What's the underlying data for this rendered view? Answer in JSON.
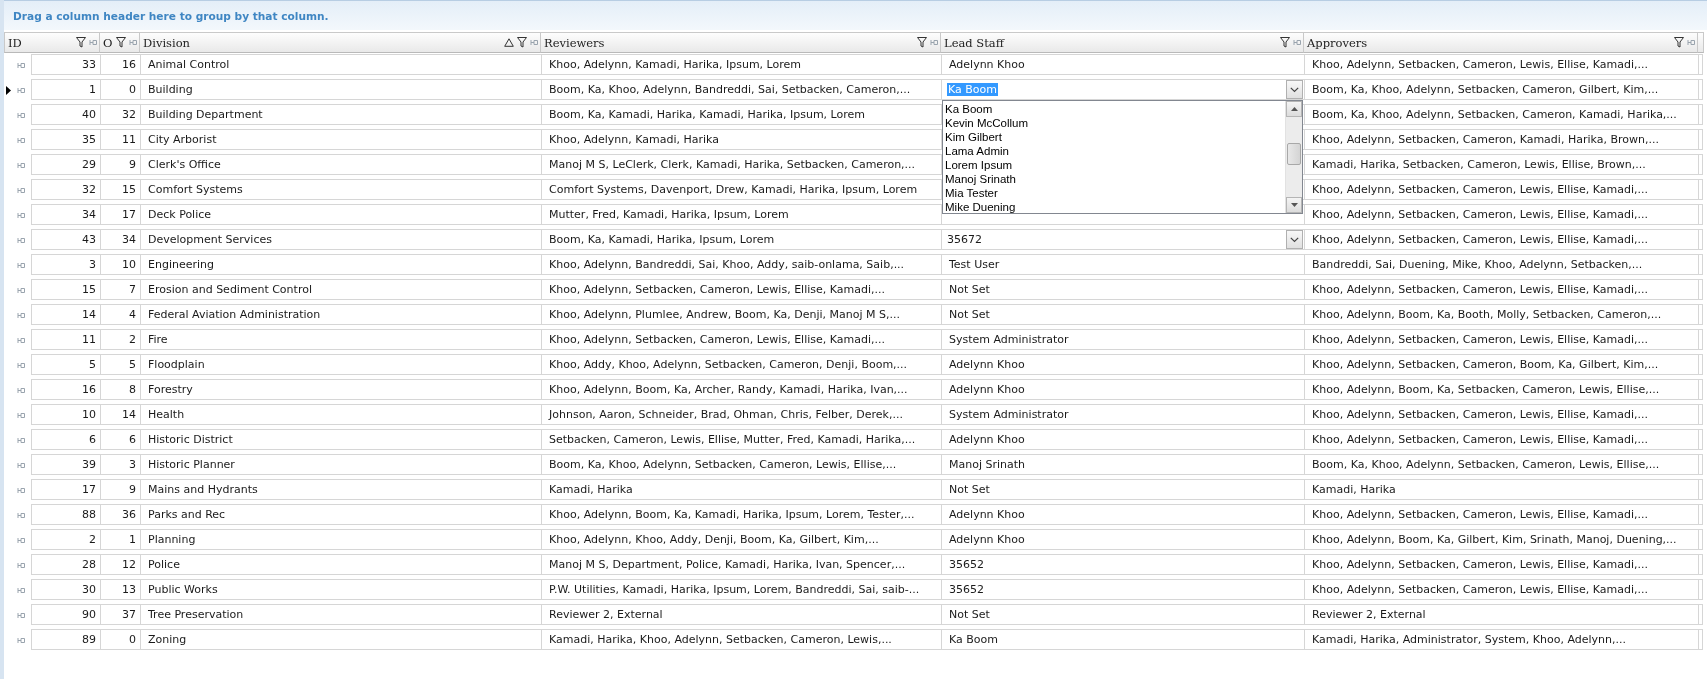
{
  "group_panel": {
    "text": "Drag a column header here to group by that column."
  },
  "columns": [
    {
      "label": "ID",
      "filter": true,
      "sorted": false
    },
    {
      "label": "O",
      "filter": true,
      "sorted": false
    },
    {
      "label": "Division",
      "filter": true,
      "sorted": true
    },
    {
      "label": "Reviewers",
      "filter": true,
      "sorted": false
    },
    {
      "label": "Lead Staff",
      "filter": true,
      "sorted": false
    },
    {
      "label": "Approvers",
      "filter": true,
      "sorted": false
    }
  ],
  "rows": [
    {
      "id": "33",
      "order": "16",
      "division": "Animal Control",
      "reviewers": "Khoo, Adelynn, Kamadi, Harika, Ipsum, Lorem",
      "lead_staff": "Adelynn Khoo",
      "approvers": "Khoo, Adelynn, Setbacken, Cameron, Lewis, Ellise, Kamadi,...",
      "selected": false,
      "editing": false,
      "dropdown_button": false
    },
    {
      "id": "1",
      "order": "0",
      "division": "Building",
      "reviewers": "Boom, Ka, Khoo, Adelynn, Bandreddi, Sai, Setbacken, Cameron,...",
      "lead_staff": "Ka Boom",
      "approvers": "Boom, Ka, Khoo, Adelynn, Setbacken, Cameron, Gilbert, Kim,...",
      "selected": true,
      "editing": true,
      "dropdown_button": true
    },
    {
      "id": "40",
      "order": "32",
      "division": "Building Department",
      "reviewers": "Boom, Ka, Kamadi, Harika, Kamadi, Harika, Ipsum, Lorem",
      "approvers": "Boom, Ka, Khoo, Adelynn, Setbacken, Cameron, Kamadi, Harika,...",
      "selected": false,
      "editing": false,
      "dropdown_button": false
    },
    {
      "id": "35",
      "order": "11",
      "division": "City Arborist",
      "reviewers": "Khoo, Adelynn, Kamadi, Harika",
      "approvers": "Khoo, Adelynn, Setbacken, Cameron, Kamadi, Harika, Brown,...",
      "selected": false,
      "editing": false,
      "dropdown_button": false
    },
    {
      "id": "29",
      "order": "9",
      "division": "Clerk's Office",
      "reviewers": "Manoj M S, LeClerk, Clerk, Kamadi, Harika, Setbacken, Cameron,...",
      "approvers": "Kamadi, Harika, Setbacken, Cameron, Lewis, Ellise, Brown,...",
      "selected": false,
      "editing": false,
      "dropdown_button": false
    },
    {
      "id": "32",
      "order": "15",
      "division": "Comfort Systems",
      "reviewers": "Comfort Systems, Davenport, Drew, Kamadi, Harika, Ipsum, Lorem",
      "approvers": "Khoo, Adelynn, Setbacken, Cameron, Lewis, Ellise, Kamadi,...",
      "selected": false,
      "editing": false,
      "dropdown_button": false
    },
    {
      "id": "34",
      "order": "17",
      "division": "Deck Police",
      "reviewers": "Mutter, Fred, Kamadi, Harika, Ipsum, Lorem",
      "approvers": "Khoo, Adelynn, Setbacken, Cameron, Lewis, Ellise, Kamadi,...",
      "selected": false,
      "editing": false,
      "dropdown_button": false
    },
    {
      "id": "43",
      "order": "34",
      "division": "Development Services",
      "reviewers": "Boom, Ka, Kamadi, Harika, Ipsum, Lorem",
      "lead_staff": "35672",
      "approvers": "Khoo, Adelynn, Setbacken, Cameron, Lewis, Ellise, Kamadi,...",
      "selected": false,
      "editing": false,
      "dropdown_button": true
    },
    {
      "id": "3",
      "order": "10",
      "division": "Engineering",
      "reviewers": "Khoo, Adelynn, Bandreddi, Sai, Khoo, Addy, saib-onlama, Saib,...",
      "lead_staff": "Test User",
      "approvers": "Bandreddi, Sai, Duening, Mike, Khoo, Adelynn, Setbacken,...",
      "selected": false,
      "editing": false,
      "dropdown_button": false
    },
    {
      "id": "15",
      "order": "7",
      "division": "Erosion and Sediment Control",
      "reviewers": "Khoo, Adelynn, Setbacken, Cameron, Lewis, Ellise, Kamadi,...",
      "lead_staff": "Not Set",
      "approvers": "Khoo, Adelynn, Setbacken, Cameron, Lewis, Ellise, Kamadi,...",
      "selected": false,
      "editing": false,
      "dropdown_button": false
    },
    {
      "id": "14",
      "order": "4",
      "division": "Federal Aviation Administration",
      "reviewers": "Khoo, Adelynn, Plumlee, Andrew, Boom, Ka, Denji, Manoj M S,...",
      "lead_staff": "Not Set",
      "approvers": "Khoo, Adelynn, Boom, Ka, Booth, Molly, Setbacken, Cameron,...",
      "selected": false,
      "editing": false,
      "dropdown_button": false
    },
    {
      "id": "11",
      "order": "2",
      "division": "Fire",
      "reviewers": "Khoo, Adelynn, Setbacken, Cameron, Lewis, Ellise, Kamadi,...",
      "lead_staff": "System Administrator",
      "approvers": "Khoo, Adelynn, Setbacken, Cameron, Lewis, Ellise, Kamadi,...",
      "selected": false,
      "editing": false,
      "dropdown_button": false
    },
    {
      "id": "5",
      "order": "5",
      "division": "Floodplain",
      "reviewers": "Khoo, Addy, Khoo, Adelynn, Setbacken, Cameron, Denji, Boom,...",
      "lead_staff": "Adelynn Khoo",
      "approvers": "Khoo, Adelynn, Setbacken, Cameron, Boom, Ka, Gilbert, Kim,...",
      "selected": false,
      "editing": false,
      "dropdown_button": false
    },
    {
      "id": "16",
      "order": "8",
      "division": "Forestry",
      "reviewers": "Khoo, Adelynn, Boom, Ka, Archer, Randy, Kamadi, Harika, Ivan,...",
      "lead_staff": "Adelynn Khoo",
      "approvers": "Khoo, Adelynn, Boom, Ka, Setbacken, Cameron, Lewis, Ellise,...",
      "selected": false,
      "editing": false,
      "dropdown_button": false
    },
    {
      "id": "10",
      "order": "14",
      "division": "Health",
      "reviewers": "Johnson, Aaron, Schneider, Brad, Ohman, Chris, Felber, Derek,...",
      "lead_staff": "System Administrator",
      "approvers": "Khoo, Adelynn, Setbacken, Cameron, Lewis, Ellise, Kamadi,...",
      "selected": false,
      "editing": false,
      "dropdown_button": false
    },
    {
      "id": "6",
      "order": "6",
      "division": "Historic District",
      "reviewers": "Setbacken, Cameron, Lewis, Ellise, Mutter, Fred, Kamadi, Harika,...",
      "lead_staff": "Adelynn Khoo",
      "approvers": "Khoo, Adelynn, Setbacken, Cameron, Lewis, Ellise, Kamadi,...",
      "selected": false,
      "editing": false,
      "dropdown_button": false
    },
    {
      "id": "39",
      "order": "3",
      "division": "Historic Planner",
      "reviewers": "Boom, Ka, Khoo, Adelynn, Setbacken, Cameron, Lewis, Ellise,...",
      "lead_staff": "Manoj Srinath",
      "approvers": "Boom, Ka, Khoo, Adelynn, Setbacken, Cameron, Lewis, Ellise,...",
      "selected": false,
      "editing": false,
      "dropdown_button": false
    },
    {
      "id": "17",
      "order": "9",
      "division": "Mains and Hydrants",
      "reviewers": "Kamadi, Harika",
      "lead_staff": "Not Set",
      "approvers": "Kamadi, Harika",
      "selected": false,
      "editing": false,
      "dropdown_button": false
    },
    {
      "id": "88",
      "order": "36",
      "division": "Parks and Rec",
      "reviewers": "Khoo, Adelynn, Boom, Ka, Kamadi, Harika, Ipsum, Lorem, Tester,...",
      "lead_staff": "Adelynn Khoo",
      "approvers": "Khoo, Adelynn, Setbacken, Cameron, Lewis, Ellise, Kamadi,...",
      "selected": false,
      "editing": false,
      "dropdown_button": false
    },
    {
      "id": "2",
      "order": "1",
      "division": "Planning",
      "reviewers": "Khoo, Adelynn, Khoo, Addy, Denji, Boom, Ka, Gilbert, Kim,...",
      "lead_staff": "Adelynn Khoo",
      "approvers": "Khoo, Adelynn, Boom, Ka, Gilbert, Kim, Srinath, Manoj, Duening,...",
      "selected": false,
      "editing": false,
      "dropdown_button": false
    },
    {
      "id": "28",
      "order": "12",
      "division": "Police",
      "reviewers": "Manoj M S, Department, Police, Kamadi, Harika, Ivan, Spencer,...",
      "lead_staff": "35652",
      "approvers": "Khoo, Adelynn, Setbacken, Cameron, Lewis, Ellise, Kamadi,...",
      "selected": false,
      "editing": false,
      "dropdown_button": false
    },
    {
      "id": "30",
      "order": "13",
      "division": "Public Works",
      "reviewers": "P.W. Utilities, Kamadi, Harika, Ipsum, Lorem, Bandreddi, Sai, saib-...",
      "lead_staff": "35652",
      "approvers": "Khoo, Adelynn, Setbacken, Cameron, Lewis, Ellise, Kamadi,...",
      "selected": false,
      "editing": false,
      "dropdown_button": false
    },
    {
      "id": "90",
      "order": "37",
      "division": "Tree Preservation",
      "reviewers": "Reviewer 2, External",
      "lead_staff": "Not Set",
      "approvers": "Reviewer 2, External",
      "selected": false,
      "editing": false,
      "dropdown_button": false
    },
    {
      "id": "89",
      "order": "0",
      "division": "Zoning",
      "reviewers": "Kamadi, Harika, Khoo, Adelynn, Setbacken, Cameron, Lewis,...",
      "lead_staff": "Ka Boom",
      "approvers": "Kamadi, Harika, Administrator, System, Khoo, Adelynn,...",
      "selected": false,
      "editing": false,
      "dropdown_button": false
    }
  ],
  "dropdown_list": {
    "items": [
      "Ka Boom",
      "Kevin McCollum",
      "Kim Gilbert",
      "Lama Admin",
      "Lorem Ipsum",
      "Manoj Srinath",
      "Mia Tester",
      "Mike Duening"
    ]
  }
}
